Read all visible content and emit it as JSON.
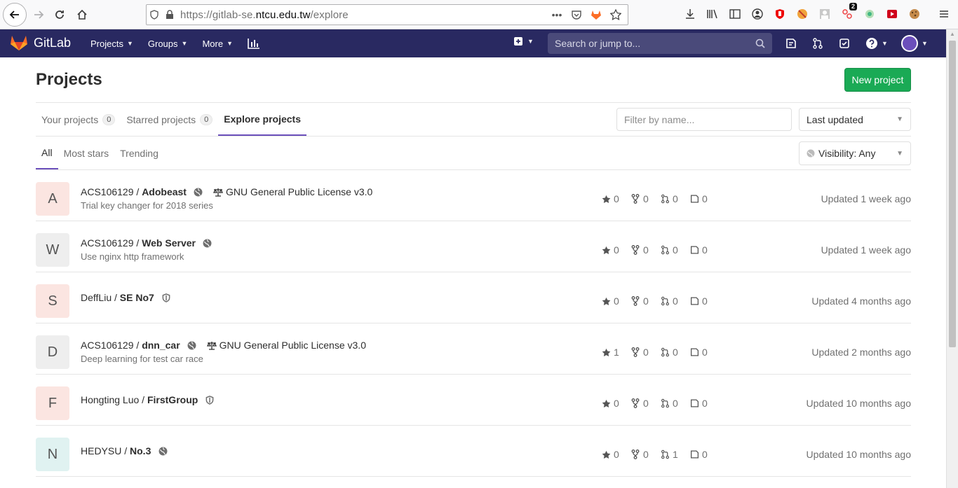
{
  "browser": {
    "url_prefix": "https://gitlab-se.",
    "url_domain": "ntcu.edu.tw",
    "url_path": "/explore",
    "badge_count": "2"
  },
  "navbar": {
    "brand": "GitLab",
    "menu": [
      {
        "label": "Projects"
      },
      {
        "label": "Groups"
      },
      {
        "label": "More"
      }
    ],
    "search_placeholder": "Search or jump to..."
  },
  "page": {
    "title": "Projects",
    "new_project_label": "New project"
  },
  "tabs": [
    {
      "label": "Your projects",
      "count": "0"
    },
    {
      "label": "Starred projects",
      "count": "0"
    },
    {
      "label": "Explore projects"
    }
  ],
  "filters": {
    "filter_placeholder": "Filter by name...",
    "sort_value": "Last updated",
    "visibility_value": "Visibility: Any"
  },
  "subtabs": [
    "All",
    "Most stars",
    "Trending"
  ],
  "projects": [
    {
      "initial": "A",
      "avatar_bg": "#fbe5e1",
      "namespace": "ACS106129 /",
      "name": "Adobeast",
      "visibility": "globe-icon",
      "license": "GNU General Public License v3.0",
      "description": "Trial key changer for 2018 series",
      "stars": "0",
      "forks": "0",
      "merge_requests": "0",
      "issues": "0",
      "updated": "Updated 1 week ago"
    },
    {
      "initial": "W",
      "avatar_bg": "#eeeeee",
      "namespace": "ACS106129 /",
      "name": "Web Server",
      "visibility": "globe-icon",
      "license": "",
      "description": "Use nginx http framework",
      "stars": "0",
      "forks": "0",
      "merge_requests": "0",
      "issues": "0",
      "updated": "Updated 1 week ago"
    },
    {
      "initial": "S",
      "avatar_bg": "#fbe5e1",
      "namespace": "DeffLiu /",
      "name": "SE No7",
      "visibility": "shield-icon",
      "license": "",
      "description": "",
      "stars": "0",
      "forks": "0",
      "merge_requests": "0",
      "issues": "0",
      "updated": "Updated 4 months ago"
    },
    {
      "initial": "D",
      "avatar_bg": "#eeeeee",
      "namespace": "ACS106129 /",
      "name": "dnn_car",
      "visibility": "globe-icon",
      "license": "GNU General Public License v3.0",
      "description": "Deep learning for test car race",
      "stars": "1",
      "forks": "0",
      "merge_requests": "0",
      "issues": "0",
      "updated": "Updated 2 months ago"
    },
    {
      "initial": "F",
      "avatar_bg": "#fbe5e1",
      "namespace": "Hongting Luo /",
      "name": "FirstGroup",
      "visibility": "shield-icon",
      "license": "",
      "description": "",
      "stars": "0",
      "forks": "0",
      "merge_requests": "0",
      "issues": "0",
      "updated": "Updated 10 months ago"
    },
    {
      "initial": "N",
      "avatar_bg": "#e0f2f1",
      "namespace": "HEDYSU /",
      "name": "No.3",
      "visibility": "globe-icon",
      "license": "",
      "description": "",
      "stars": "0",
      "forks": "0",
      "merge_requests": "1",
      "issues": "0",
      "updated": "Updated 10 months ago"
    }
  ],
  "colors": {
    "navbar_bg": "#292961",
    "accent": "#6b4fbb",
    "primary_button": "#1aaa55"
  }
}
